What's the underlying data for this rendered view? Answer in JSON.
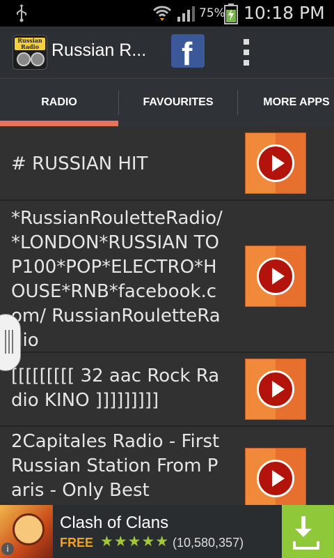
{
  "status_bar": {
    "battery_percent": "75%",
    "time": "10:18 PM",
    "icons": [
      "usb-icon",
      "wifi-icon",
      "signal-icon",
      "battery-charging-icon"
    ]
  },
  "action_bar": {
    "app_icon_text": "Russian Radio",
    "title": "Russian R...",
    "facebook_icon_text": "f"
  },
  "tabs": [
    {
      "label": "RADIO",
      "selected": true
    },
    {
      "label": "FAVOURITES",
      "selected": false
    },
    {
      "label": "MORE APPS",
      "selected": false
    }
  ],
  "stations": [
    {
      "name": "# RUSSIAN HIT"
    },
    {
      "name": "*RussianRouletteRadio/*LONDON*RUSSIAN TOP100*POP*ELECTRO*HOUSE*RNB*facebook.com/ RussianRouletteRadio"
    },
    {
      "name": "[[[[[[[[[ 32 aac Rock Radio KINO ]]]]]]]]]"
    },
    {
      "name": "2Capitales Radio - First Russian Station From Paris - Only Best"
    }
  ],
  "ad": {
    "title": "Clash of Clans",
    "price": "FREE",
    "rating_stars": 4.5,
    "stars_text": "★★★★★",
    "review_count": "(10,580,357)",
    "info_icon_text": "i"
  },
  "colors": {
    "tab_indicator": "#e8735a",
    "play_button": "#f08a3a",
    "facebook": "#3b5998",
    "download": "#8fc93a"
  }
}
